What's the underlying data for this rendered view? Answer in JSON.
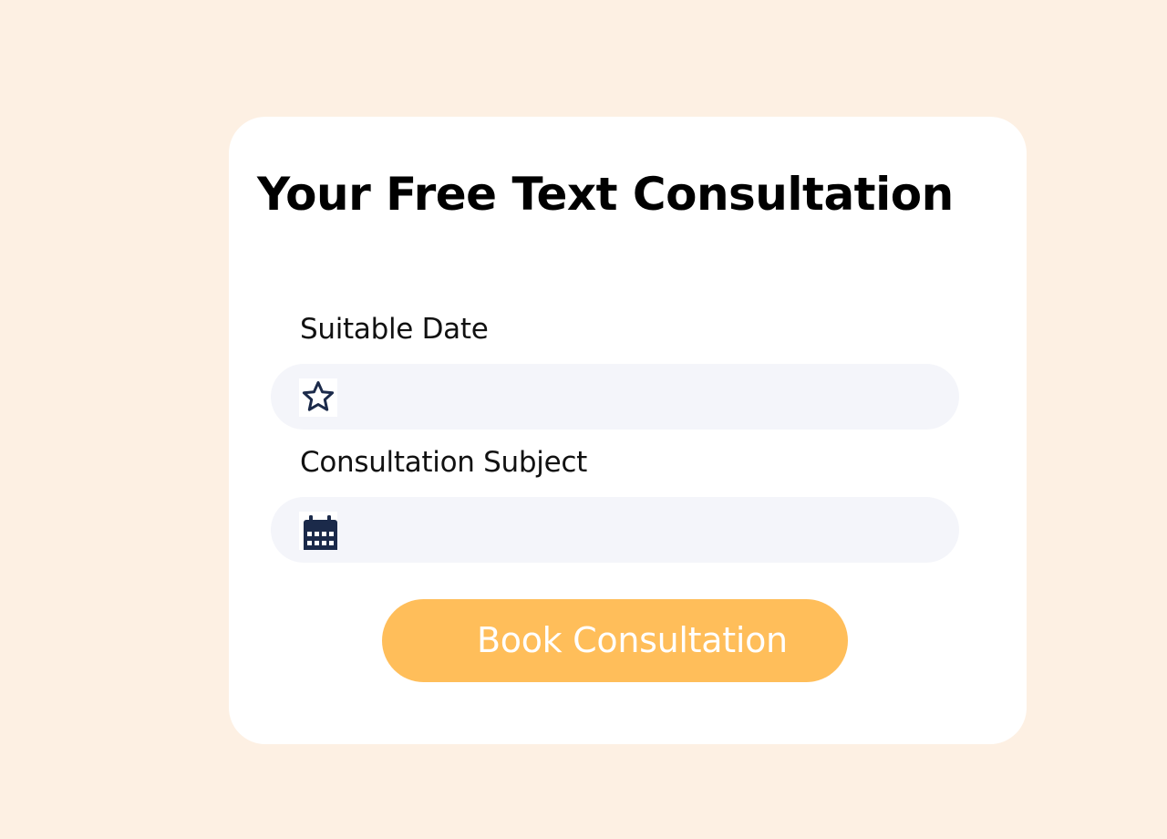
{
  "form": {
    "title": "Your Free Text Consultation",
    "fields": [
      {
        "label": "Suitable Date",
        "icon": "star-outline-icon",
        "value": "",
        "placeholder": ""
      },
      {
        "label": "Consultation Subject",
        "icon": "calendar-icon",
        "value": "",
        "placeholder": ""
      }
    ],
    "submit_label": "Book Consultation"
  },
  "colors": {
    "page_background": "#fdf0e3",
    "card_background": "#ffffff",
    "field_background": "#f4f5fa",
    "icon_color": "#1b2a4a",
    "button_background": "#ffbe5a",
    "button_text": "#ffffff"
  }
}
